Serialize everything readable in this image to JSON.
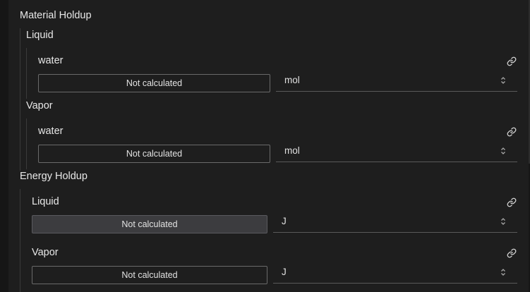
{
  "material_holdup": {
    "title": "Material Holdup",
    "liquid": {
      "title": "Liquid",
      "component": "water",
      "value": "Not calculated",
      "unit": "mol"
    },
    "vapor": {
      "title": "Vapor",
      "component": "water",
      "value": "Not calculated",
      "unit": "mol"
    }
  },
  "energy_holdup": {
    "title": "Energy Holdup",
    "liquid": {
      "title": "Liquid",
      "value": "Not calculated",
      "unit": "J"
    },
    "vapor": {
      "title": "Vapor",
      "value": "Not calculated",
      "unit": "J"
    }
  },
  "icons": {
    "link": "link-icon",
    "select": "chevron-up-down-icon"
  }
}
